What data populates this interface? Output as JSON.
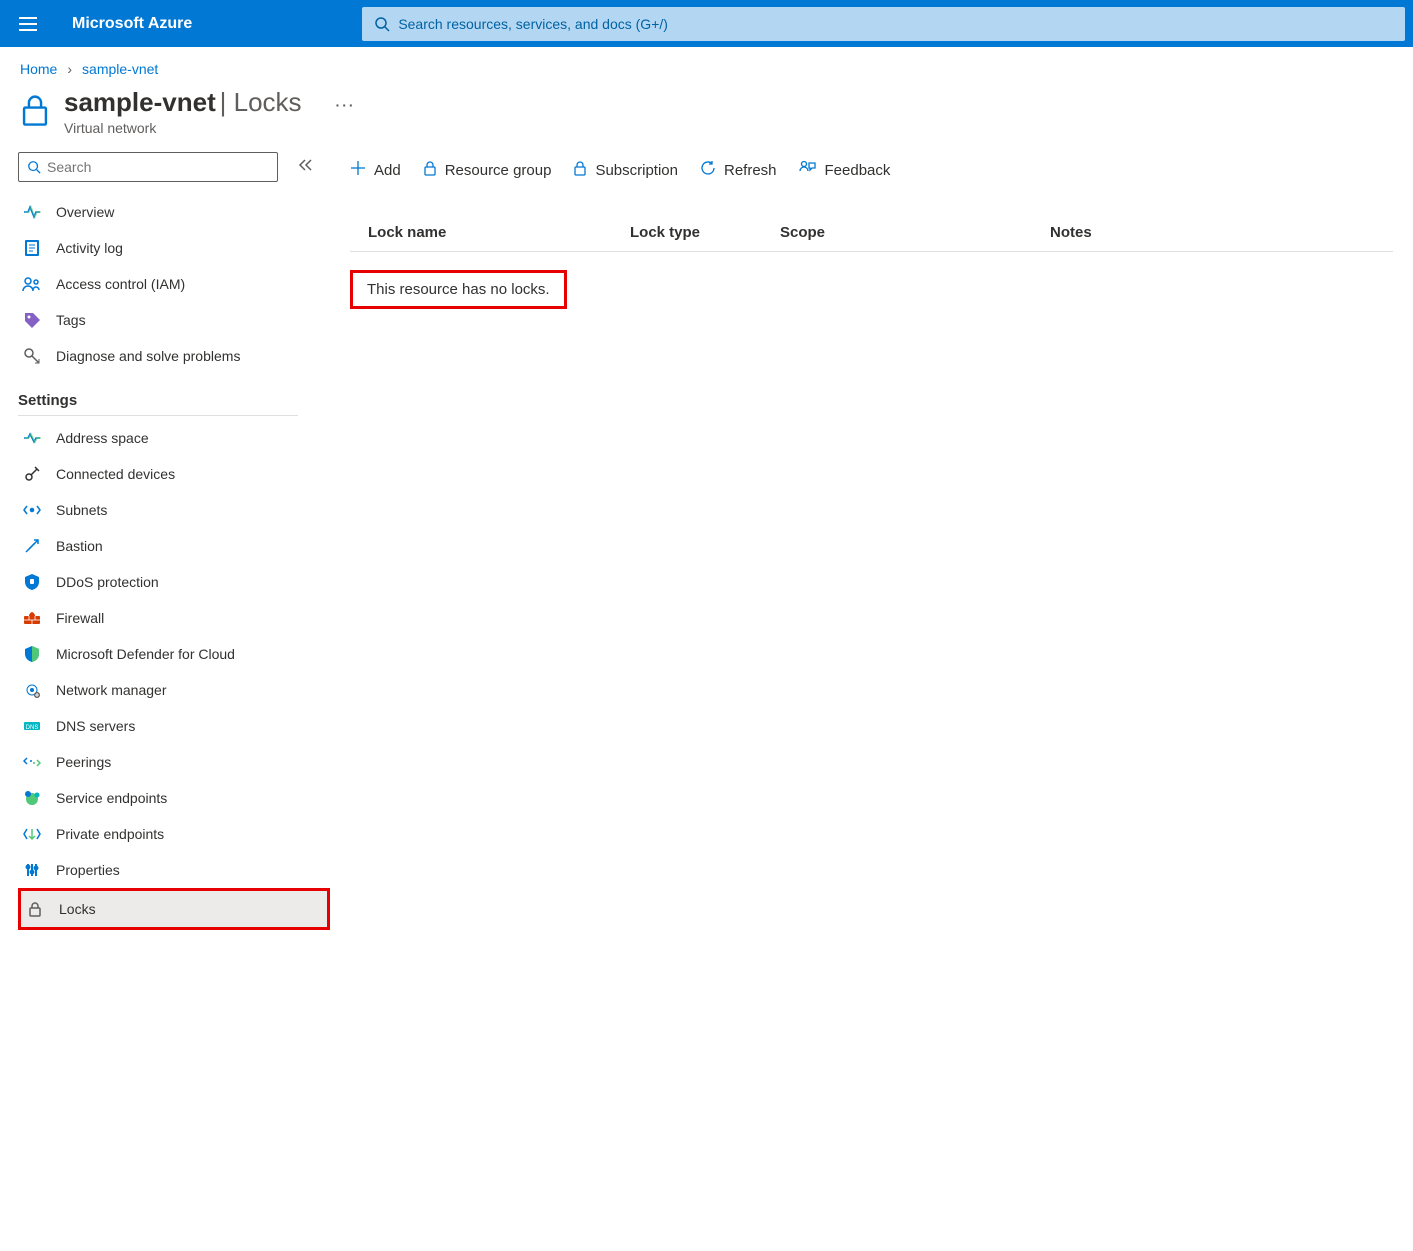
{
  "header": {
    "brand": "Microsoft Azure",
    "search_placeholder": "Search resources, services, and docs (G+/)"
  },
  "breadcrumb": {
    "home": "Home",
    "resource": "sample-vnet"
  },
  "page": {
    "title_resource": "sample-vnet",
    "title_section": "Locks",
    "subtitle": "Virtual network"
  },
  "sidebar": {
    "search_placeholder": "Search",
    "top_items": [
      {
        "label": "Overview"
      },
      {
        "label": "Activity log"
      },
      {
        "label": "Access control (IAM)"
      },
      {
        "label": "Tags"
      },
      {
        "label": "Diagnose and solve problems"
      }
    ],
    "group_label": "Settings",
    "settings_items": [
      {
        "label": "Address space"
      },
      {
        "label": "Connected devices"
      },
      {
        "label": "Subnets"
      },
      {
        "label": "Bastion"
      },
      {
        "label": "DDoS protection"
      },
      {
        "label": "Firewall"
      },
      {
        "label": "Microsoft Defender for Cloud"
      },
      {
        "label": "Network manager"
      },
      {
        "label": "DNS servers"
      },
      {
        "label": "Peerings"
      },
      {
        "label": "Service endpoints"
      },
      {
        "label": "Private endpoints"
      },
      {
        "label": "Properties"
      },
      {
        "label": "Locks"
      }
    ]
  },
  "toolbar": {
    "add": "Add",
    "resource_group": "Resource group",
    "subscription": "Subscription",
    "refresh": "Refresh",
    "feedback": "Feedback"
  },
  "table": {
    "col_lockname": "Lock name",
    "col_locktype": "Lock type",
    "col_scope": "Scope",
    "col_notes": "Notes",
    "empty_message": "This resource has no locks."
  }
}
